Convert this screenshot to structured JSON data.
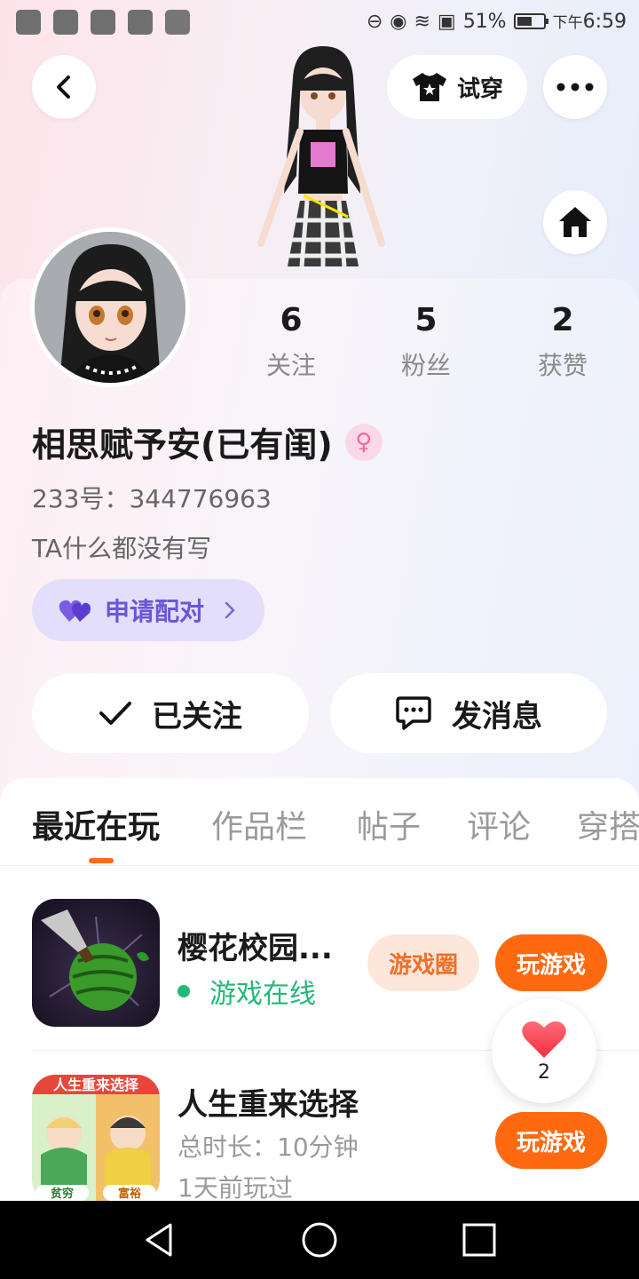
{
  "status_bar": {
    "battery": "51%",
    "time_prefix": "下午",
    "time": "6:59"
  },
  "header": {
    "tryon_label": "试穿"
  },
  "profile": {
    "stats": [
      {
        "value": "6",
        "label": "关注"
      },
      {
        "value": "5",
        "label": "粉丝"
      },
      {
        "value": "2",
        "label": "获赞"
      }
    ],
    "nickname": "相思赋予安(已有闺)",
    "gender_symbol": "♀",
    "uid": "233号：344776963",
    "bio": "TA什么都没有写",
    "pair_label": "申请配对",
    "follow_label": "已关注",
    "message_label": "发消息"
  },
  "tabs": [
    "最近在玩",
    "作品栏",
    "帖子",
    "评论",
    "穿搭"
  ],
  "games": [
    {
      "title": "樱花校园...",
      "status": "游戏在线",
      "circle_label": "游戏圈",
      "play_label": "玩游戏"
    },
    {
      "title": "人生重来选择",
      "duration": "总时长：10分钟",
      "last_played": "1天前玩过",
      "play_label": "玩游戏",
      "icon_banner": "人生重来选择",
      "icon_left_tag": "贫穷",
      "icon_right_tag": "富裕"
    }
  ],
  "like_float": {
    "count": "2"
  },
  "colors": {
    "accent_orange": "#ff6a10",
    "online_green": "#21b97a",
    "pair_purple": "#6a57d8"
  }
}
